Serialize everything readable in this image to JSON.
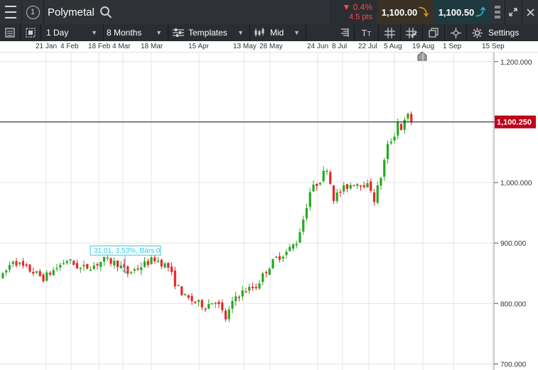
{
  "topbar": {
    "window_number": "1",
    "instrument": "Polymetal",
    "change_pct": "▼ 0.4%",
    "change_pts": "4.5 pts",
    "sell_price": "1,100.00",
    "buy_price": "1,100.50"
  },
  "toolbar": {
    "interval": "1 Day",
    "range": "8 Months",
    "templates": "Templates",
    "price_type": "Mid",
    "settings": "Settings"
  },
  "colors": {
    "up": "#27a822",
    "down": "#e8262a",
    "price_tag": "#c0001a",
    "measure": "#3cc6e0"
  },
  "chart_data": {
    "type": "candlestick",
    "x_ticks": [
      "21 Jan",
      "4 Feb",
      "18 Feb",
      "4 Mar",
      "18 Mar",
      "15 Apr",
      "13 May",
      "28 May",
      "24 Jun",
      "8 Jul",
      "22 Jul",
      "5 Aug",
      "19 Aug",
      "1 Sep",
      "15 Sep"
    ],
    "y_ticks": [
      "1,200.000",
      "1,100.000",
      "1,000.000",
      "900.000",
      "800.000",
      "700.000"
    ],
    "ylim": [
      690,
      1215
    ],
    "current_price": 1100.25,
    "current_price_label": "1,100.250",
    "measure_label": "31.01, 3.53%, Bars:0",
    "trend": [
      [
        0,
        845
      ],
      [
        3,
        872
      ],
      [
        6,
        860
      ],
      [
        9,
        852
      ],
      [
        12,
        842
      ],
      [
        15,
        855
      ],
      [
        19,
        872
      ],
      [
        23,
        858
      ],
      [
        27,
        863
      ],
      [
        30,
        872
      ],
      [
        34,
        866
      ],
      [
        37,
        850
      ],
      [
        41,
        862
      ],
      [
        45,
        874
      ],
      [
        49,
        860
      ],
      [
        51,
        834
      ],
      [
        54,
        810
      ],
      [
        57,
        802
      ],
      [
        60,
        796
      ],
      [
        63,
        806
      ],
      [
        66,
        775
      ],
      [
        69,
        812
      ],
      [
        72,
        822
      ],
      [
        75,
        828
      ],
      [
        78,
        855
      ],
      [
        81,
        875
      ],
      [
        84,
        885
      ],
      [
        87,
        902
      ],
      [
        89,
        940
      ],
      [
        91,
        985
      ],
      [
        94,
        1005
      ],
      [
        96,
        1025
      ],
      [
        97,
        1000
      ],
      [
        98,
        975
      ],
      [
        101,
        990
      ],
      [
        104,
        1000
      ],
      [
        107,
        998
      ],
      [
        109,
        990
      ],
      [
        110,
        972
      ],
      [
        112,
        1010
      ],
      [
        114,
        1060
      ],
      [
        116,
        1080
      ],
      [
        117,
        1100
      ],
      [
        118,
        1090
      ],
      [
        120,
        1110
      ],
      [
        121,
        1102
      ]
    ]
  }
}
